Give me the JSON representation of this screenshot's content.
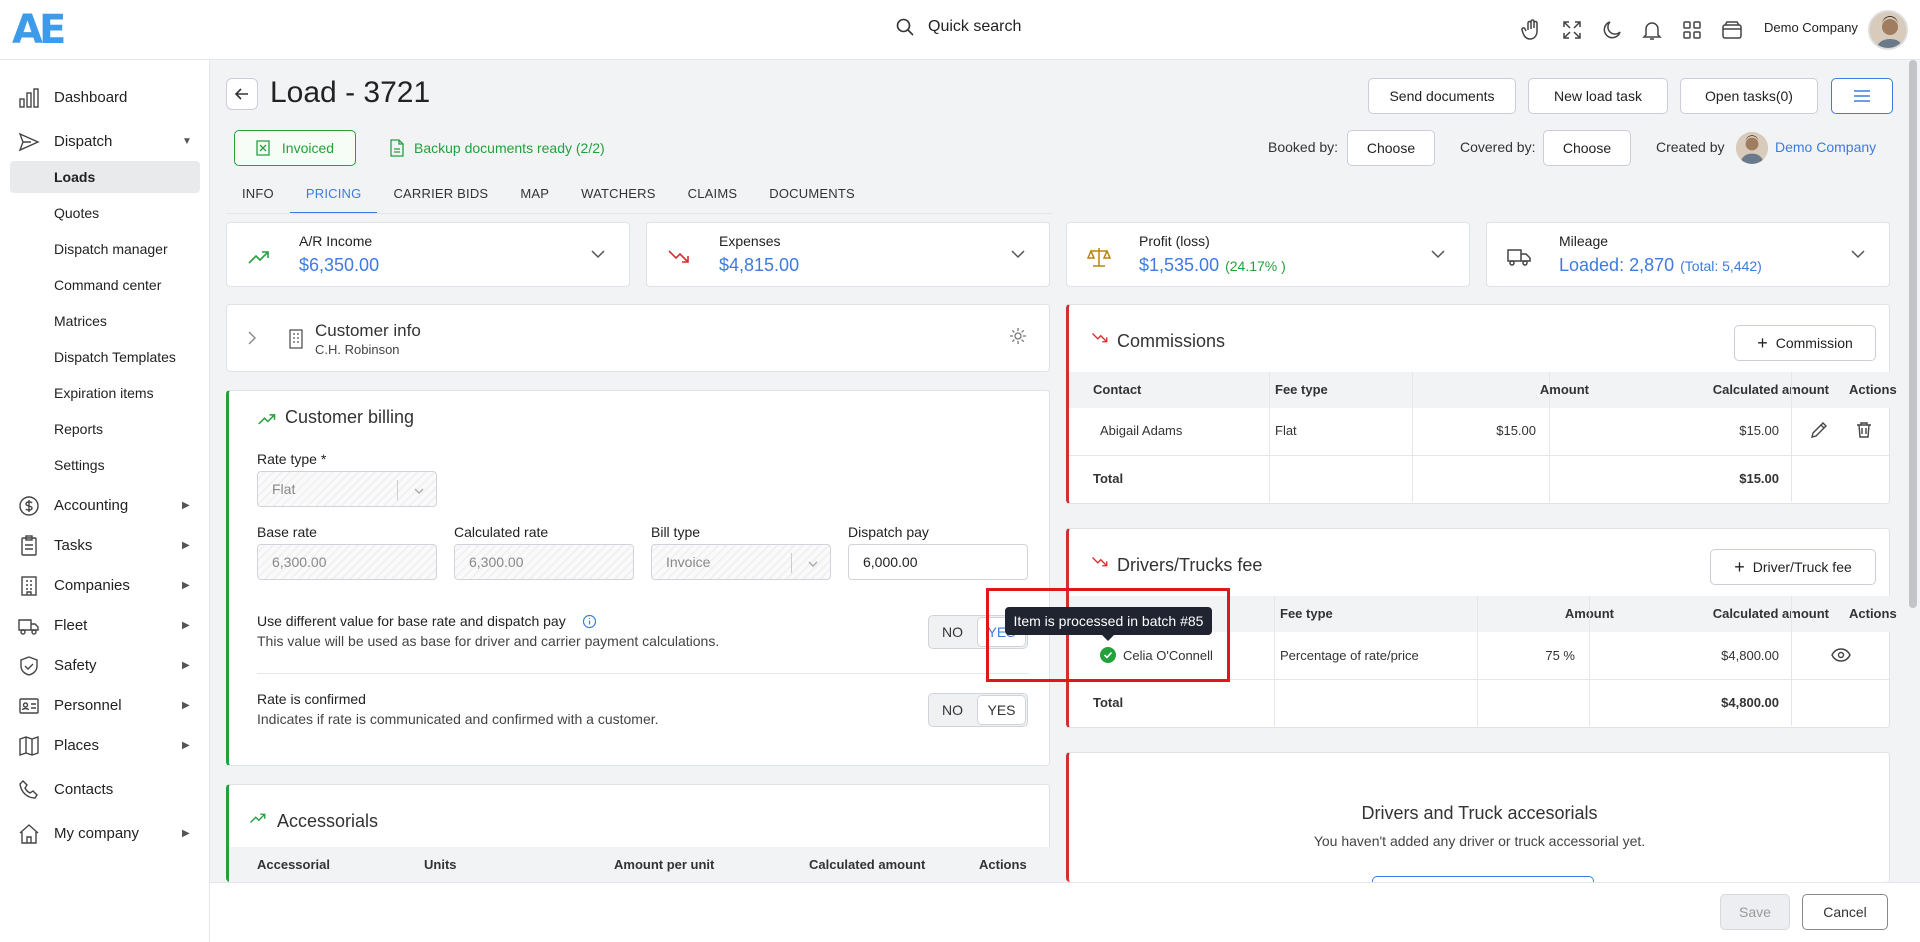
{
  "header": {
    "logo": "AE",
    "search_label": "Quick search",
    "company": "Demo Company",
    "icons": [
      "hand-icon",
      "fullscreen-icon",
      "moon-icon",
      "bell-icon",
      "apps-icon",
      "wallet-icon"
    ]
  },
  "sidebar": {
    "items": [
      {
        "label": "Dashboard",
        "icon": "chart-icon"
      },
      {
        "label": "Dispatch",
        "icon": "send-icon",
        "expanded": true
      },
      {
        "label": "Accounting",
        "icon": "dollar-icon"
      },
      {
        "label": "Tasks",
        "icon": "clipboard-icon"
      },
      {
        "label": "Companies",
        "icon": "building-icon"
      },
      {
        "label": "Fleet",
        "icon": "truck-icon"
      },
      {
        "label": "Safety",
        "icon": "shield-icon"
      },
      {
        "label": "Personnel",
        "icon": "id-card-icon"
      },
      {
        "label": "Places",
        "icon": "map-icon"
      },
      {
        "label": "Contacts",
        "icon": "phone-icon"
      },
      {
        "label": "My company",
        "icon": "home-icon"
      }
    ],
    "dispatch_sub": [
      "Loads",
      "Quotes",
      "Dispatch manager",
      "Command center",
      "Matrices",
      "Dispatch Templates",
      "Expiration items",
      "Reports",
      "Settings"
    ],
    "active_sub": "Loads"
  },
  "load": {
    "title": "Load - 3721",
    "buttons": {
      "send": "Send documents",
      "new_task": "New load task",
      "open_tasks": "Open tasks(0)"
    },
    "status": "Invoiced",
    "backup": "Backup documents ready (2/2)",
    "booked_by_label": "Booked by:",
    "covered_by_label": "Covered by:",
    "choose": "Choose",
    "created_by_label": "Created by",
    "created_by": "Demo Company"
  },
  "tabs": [
    "INFO",
    "PRICING",
    "CARRIER BIDS",
    "MAP",
    "WATCHERS",
    "CLAIMS",
    "DOCUMENTS"
  ],
  "active_tab": "PRICING",
  "summary": {
    "income": {
      "label": "A/R Income",
      "value": "$6,350.00"
    },
    "expenses": {
      "label": "Expenses",
      "value": "$4,815.00"
    },
    "profit": {
      "label": "Profit (loss)",
      "value": "$1,535.00",
      "pct": "(24.17% )"
    },
    "mileage": {
      "label": "Mileage",
      "value": "Loaded: 2,870",
      "total": "(Total: 5,442)"
    }
  },
  "customer_info": {
    "title": "Customer info",
    "name": "C.H. Robinson"
  },
  "billing": {
    "title": "Customer billing",
    "rate_type_label": "Rate type *",
    "rate_type": "Flat",
    "base_rate_label": "Base rate",
    "base_rate": "6,300.00",
    "calc_rate_label": "Calculated rate",
    "calc_rate": "6,300.00",
    "bill_type_label": "Bill type",
    "bill_type": "Invoice",
    "dispatch_pay_label": "Dispatch pay",
    "dispatch_pay": "6,000.00",
    "diff_title": "Use different value for base rate and dispatch pay",
    "diff_desc": "This value will be used as base for driver and carrier payment calculations.",
    "confirmed_title": "Rate is confirmed",
    "confirmed_desc": "Indicates if rate is communicated and confirmed with a customer.",
    "no": "NO",
    "yes": "YES"
  },
  "accessorials": {
    "title": "Accessorials",
    "columns": [
      "Accessorial",
      "Units",
      "Amount per unit",
      "Calculated amount",
      "Actions"
    ]
  },
  "commissions": {
    "title": "Commissions",
    "add": "Commission",
    "columns": [
      "Contact",
      "Fee type",
      "Amount",
      "Calculated amount",
      "Actions"
    ],
    "row": {
      "contact": "Abigail Adams",
      "fee_type": "Flat",
      "amount": "$15.00",
      "calc": "$15.00"
    },
    "total_label": "Total",
    "total": "$15.00"
  },
  "drivers_fee": {
    "title": "Drivers/Trucks fee",
    "add": "Driver/Truck fee",
    "columns": [
      "Fee type",
      "Amount",
      "Calculated amount",
      "Actions"
    ],
    "row": {
      "contact": "Celia O'Connell",
      "fee_type": "Percentage of rate/price",
      "amount": "75 %",
      "calc": "$4,800.00"
    },
    "total_label": "Total",
    "total": "$4,800.00",
    "tooltip": "Item is processed in batch #85"
  },
  "accesorials_empty": {
    "title": "Drivers and Truck accesorials",
    "desc": "You haven't added any driver or truck accessorial yet."
  },
  "footer": {
    "save": "Save",
    "cancel": "Cancel"
  },
  "colors": {
    "accent": "#3d7be0",
    "success": "#23a13c",
    "danger": "#d32f2f",
    "highlight": "#e0161b"
  }
}
